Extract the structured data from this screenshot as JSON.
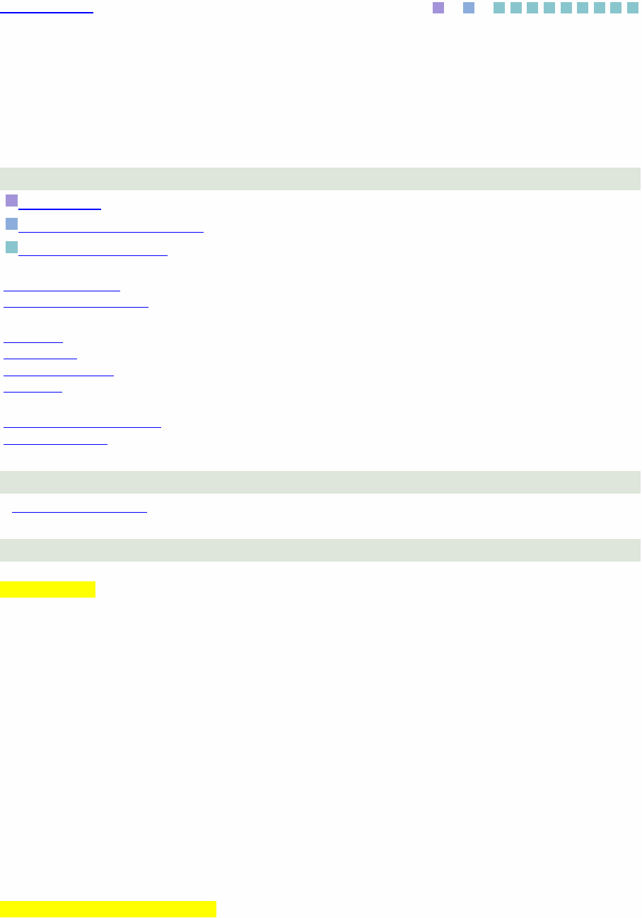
{
  "nav_squares": [
    {
      "color": "#a394d9"
    },
    {
      "color": "#8caddb"
    },
    {
      "color": "#89c5cc"
    },
    {
      "color": "#89c5cc"
    },
    {
      "color": "#89c5cc"
    },
    {
      "color": "#89c5cc"
    },
    {
      "color": "#89c5cc"
    },
    {
      "color": "#89c5cc"
    },
    {
      "color": "#89c5cc"
    },
    {
      "color": "#89c5cc"
    },
    {
      "color": "#89c5cc"
    }
  ],
  "legend": [
    {
      "color": "#a394d9"
    },
    {
      "color": "#8caddb"
    },
    {
      "color": "#89c5cc"
    }
  ]
}
